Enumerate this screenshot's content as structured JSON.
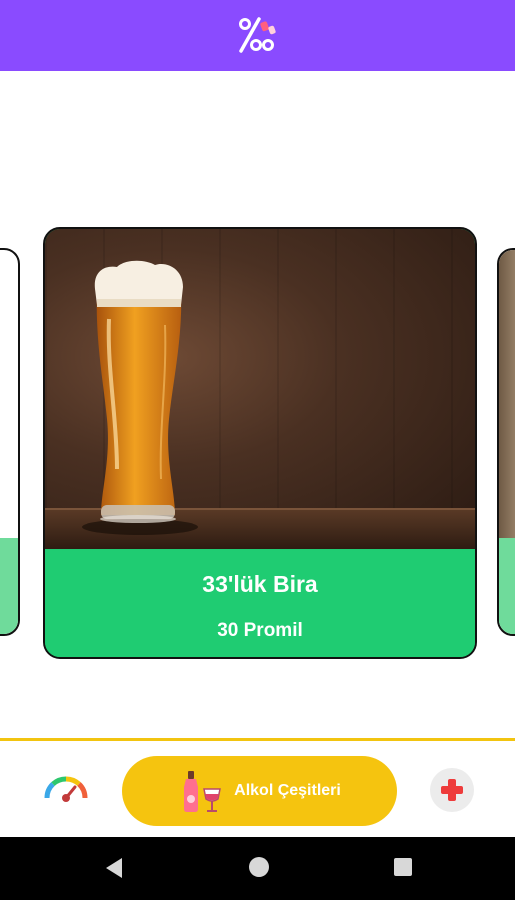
{
  "app": {
    "logo_icon": "percent-logo-icon",
    "accent_color": "#8a4bff"
  },
  "carousel": {
    "current_card": {
      "title": "33'lük Bira",
      "subtitle": "30 Promil",
      "image_icon": "beer-glass-image",
      "card_color": "#1fcc72"
    }
  },
  "bottom_nav": {
    "left_icon": "gauge-icon",
    "center_label": "Alkol Çeşitleri",
    "center_icon": "bottle-glass-icon",
    "center_color": "#f5c40f",
    "right_icon": "plus-icon"
  },
  "system_nav": {
    "back": "back-icon",
    "home": "home-icon",
    "recent": "recent-apps-icon"
  }
}
